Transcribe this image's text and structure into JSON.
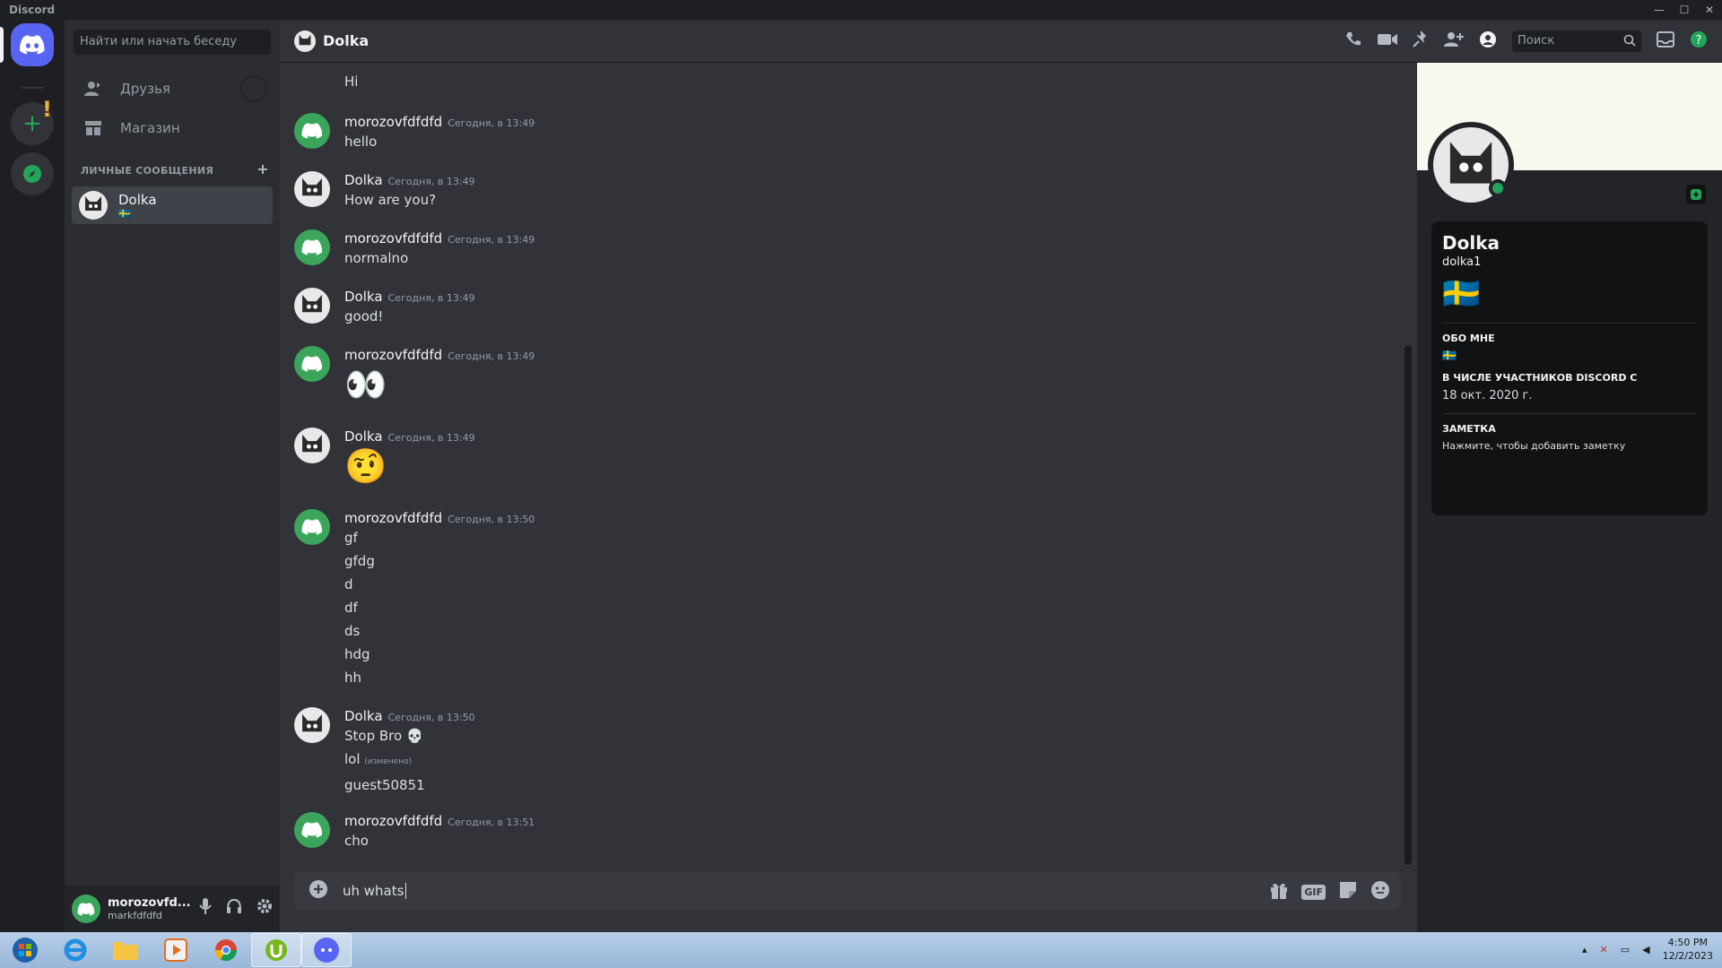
{
  "window": {
    "title": "Discord",
    "controls": [
      "—",
      "☐",
      "✕"
    ]
  },
  "dm_sidebar": {
    "search_placeholder": "Найти или начать беседу",
    "nav": [
      {
        "label": "Друзья",
        "icon": "friends-icon"
      },
      {
        "label": "Магазин",
        "icon": "shop-icon"
      }
    ],
    "section_header": "ЛИЧНЫЕ СООБЩЕНИЯ",
    "add_label": "+",
    "dms": [
      {
        "name": "Dolka",
        "status_flag": "🇸🇪"
      }
    ]
  },
  "user_panel": {
    "display_name": "morozovfd...",
    "username": "markfdfdfd"
  },
  "chat": {
    "channel_name": "Dolka",
    "search_placeholder": "Поиск",
    "first_line": "Hi",
    "messages": [
      {
        "author": "morozovfdfdfd",
        "time": "Сегодня, в 13:49",
        "lines": [
          "hello"
        ],
        "avatar": "discord"
      },
      {
        "author": "Dolka",
        "time": "Сегодня, в 13:49",
        "lines": [
          "How are you?"
        ],
        "avatar": "cat"
      },
      {
        "author": "morozovfdfdfd",
        "time": "Сегодня, в 13:49",
        "lines": [
          "normalno"
        ],
        "avatar": "discord"
      },
      {
        "author": "Dolka",
        "time": "Сегодня, в 13:49",
        "lines": [
          "good!"
        ],
        "avatar": "cat"
      },
      {
        "author": "morozovfdfdfd",
        "time": "Сегодня, в 13:49",
        "emoji": "👀",
        "avatar": "discord"
      },
      {
        "author": "Dolka",
        "time": "Сегодня, в 13:49",
        "emoji": "🤨",
        "avatar": "cat"
      },
      {
        "author": "morozovfdfdfd",
        "time": "Сегодня, в 13:50",
        "lines": [
          "gf",
          "gfdg",
          "d",
          "df",
          "ds",
          "hdg",
          "hh"
        ],
        "avatar": "discord"
      },
      {
        "author": "Dolka",
        "time": "Сегодня, в 13:50",
        "lines": [
          "Stop Bro 💀",
          "lol",
          "guest50851"
        ],
        "edited": "(изменено)",
        "avatar": "cat"
      },
      {
        "author": "morozovfdfdfd",
        "time": "Сегодня, в 13:51",
        "lines": [
          "cho"
        ],
        "avatar": "discord"
      }
    ],
    "composer_value": "uh whats",
    "composer_gif_label": "GIF"
  },
  "profile": {
    "display_name": "Dolka",
    "username": "dolka1",
    "flag": "🇸🇪",
    "about_header": "ОБО МНЕ",
    "about_value": "🇸🇪",
    "member_since_header": "В ЧИСЛЕ УЧАСТНИКОВ DISCORD С",
    "member_since_value": "18 окт. 2020 г.",
    "note_header": "ЗАМЕТКА",
    "note_placeholder": "Нажмите, чтобы добавить заметку"
  },
  "taskbar": {
    "time": "4:50 PM",
    "date": "12/2/2023"
  },
  "colors": {
    "brand": "#5865f2",
    "online": "#23a55a",
    "bg": "#313338"
  }
}
